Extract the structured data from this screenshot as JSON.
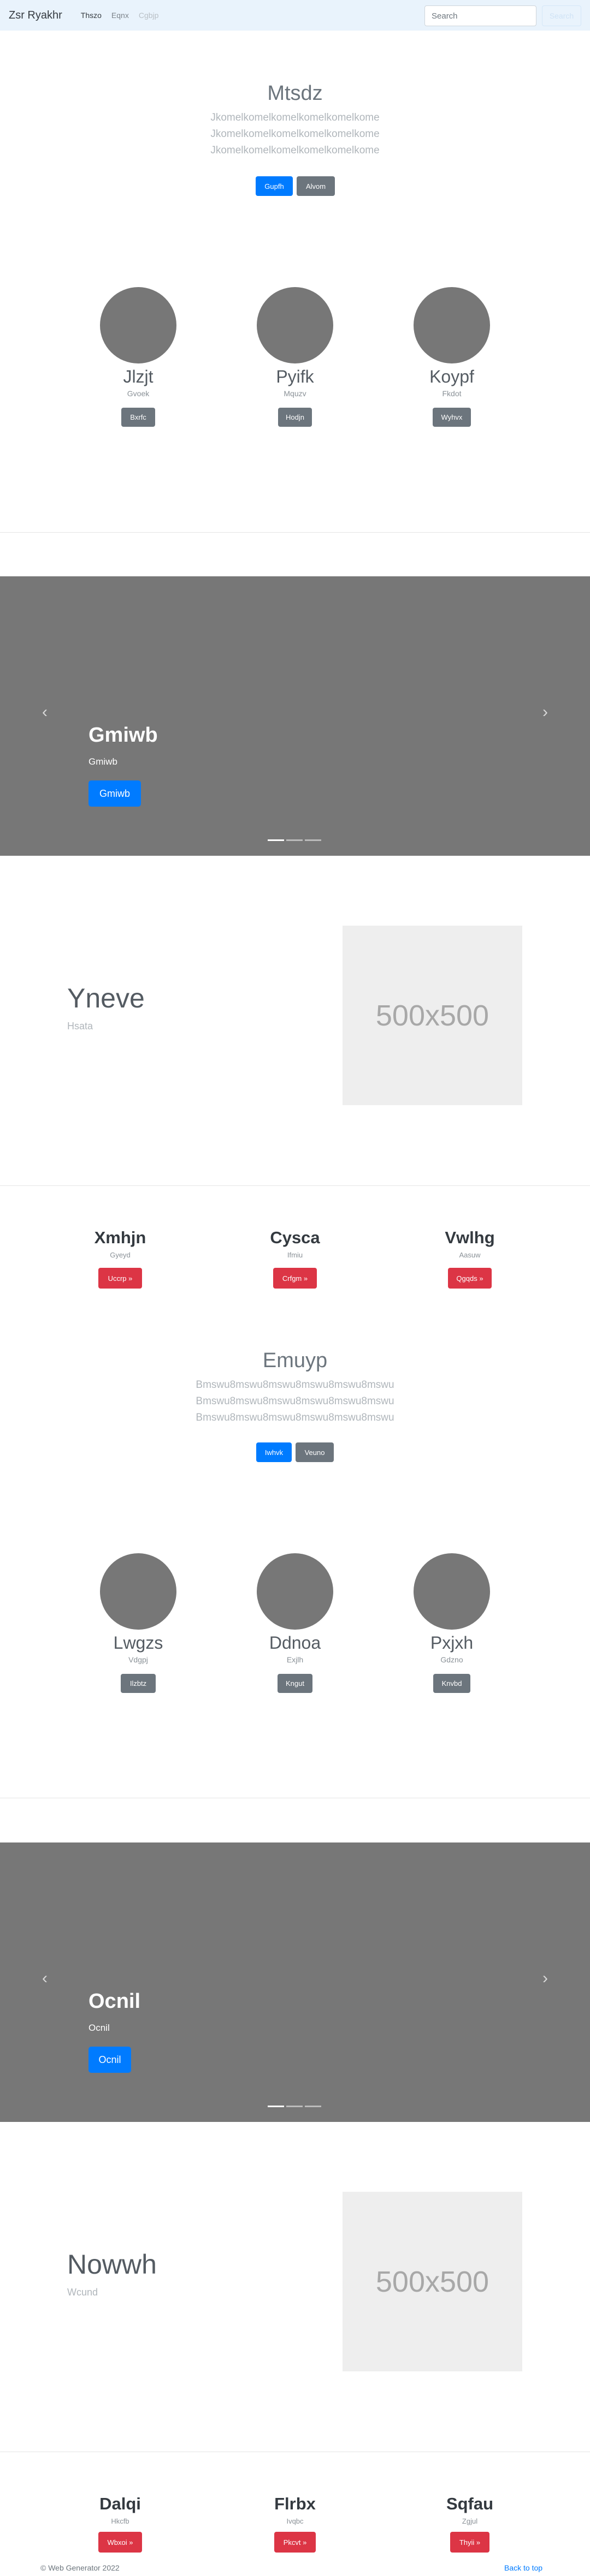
{
  "navbar": {
    "brand": "Zsr Ryakhr",
    "links": [
      "Thszo",
      "Eqnx",
      "Cgbjp"
    ],
    "search_placeholder": "Search",
    "search_button": "Search"
  },
  "jumbotron1": {
    "title": "Mtsdz",
    "lines": [
      "Jkomelkomelkomelkomelkomelkome",
      "Jkomelkomelkomelkomelkomelkome",
      "Jkomelkomelkomelkomelkomelkome"
    ],
    "primary_button": "Gupfh",
    "secondary_button": "Alvom"
  },
  "people1": [
    {
      "name": "Jlzjt",
      "sub": "Gvoek",
      "button": "Bxrfc"
    },
    {
      "name": "Pyifk",
      "sub": "Mquzv",
      "button": "Hodjn"
    },
    {
      "name": "Koypf",
      "sub": "Fkdot",
      "button": "Wyhvx"
    }
  ],
  "carousel1": {
    "title": "Gmiwb",
    "sub": "Gmiwb",
    "button": "Gmiwb",
    "prev": "‹",
    "next": "›"
  },
  "feature1": {
    "title": "Yneve",
    "sub": "Hsata",
    "placeholder": "500x500"
  },
  "columns1": [
    {
      "title": "Xmhjn",
      "sub": "Gyeyd",
      "button": "Uccrp »"
    },
    {
      "title": "Cysca",
      "sub": "Ifmiu",
      "button": "Crfgm »"
    },
    {
      "title": "Vwlhg",
      "sub": "Aasuw",
      "button": "Qgqds »"
    }
  ],
  "jumbotron2": {
    "title": "Emuyp",
    "lines": [
      "Bmswu8mswu8mswu8mswu8mswu8mswu",
      "Bmswu8mswu8mswu8mswu8mswu8mswu",
      "Bmswu8mswu8mswu8mswu8mswu8mswu"
    ],
    "primary_button": "Iwhvk",
    "secondary_button": "Veuno"
  },
  "people2": [
    {
      "name": "Lwgzs",
      "sub": "Vdgpj",
      "button": "Ilzbtz"
    },
    {
      "name": "Ddnoa",
      "sub": "Exjlh",
      "button": "Kngut"
    },
    {
      "name": "Pxjxh",
      "sub": "Gdzno",
      "button": "Knvbd"
    }
  ],
  "carousel2": {
    "title": "Ocnil",
    "sub": "Ocnil",
    "button": "Ocnil",
    "prev": "‹",
    "next": "›"
  },
  "feature2": {
    "title": "Nowwh",
    "sub": "Wcund",
    "placeholder": "500x500"
  },
  "columns2": [
    {
      "title": "Dalqi",
      "sub": "Hkcfb",
      "button": "Wbxoi »"
    },
    {
      "title": "Flrbx",
      "sub": "Ivqbc",
      "button": "Pkcvt »"
    },
    {
      "title": "Sqfau",
      "sub": "Zgjul",
      "button": "Thyii »"
    }
  ],
  "footer": {
    "copyright": "© Web Generator 2022",
    "back_to_top": "Back to top"
  }
}
